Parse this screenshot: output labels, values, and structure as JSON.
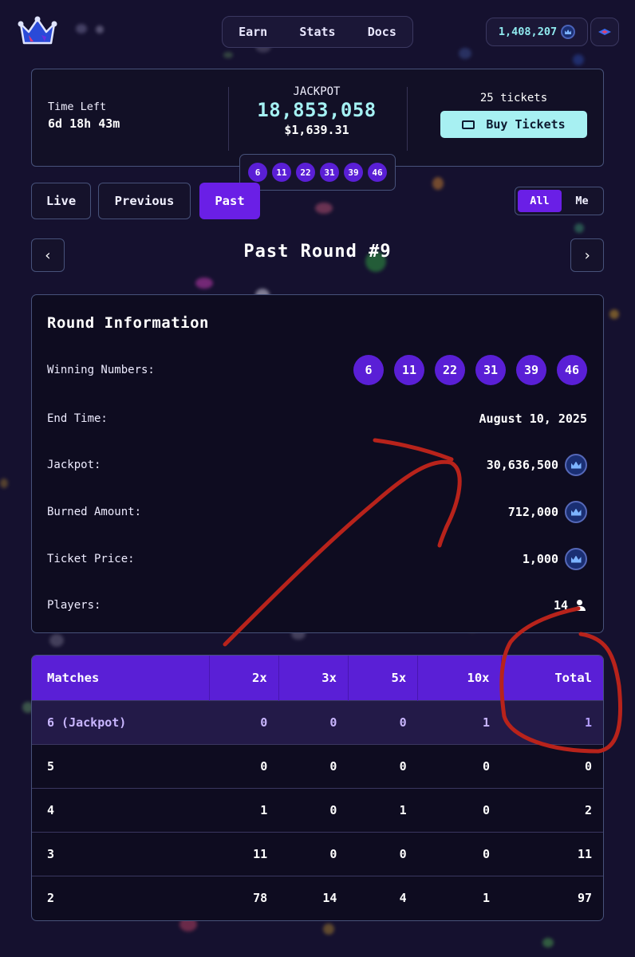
{
  "header": {
    "nav": [
      "Earn",
      "Stats",
      "Docs"
    ],
    "balance": "1,408,207"
  },
  "jackpot_panel": {
    "time_left_label": "Time Left",
    "time_left_value": "6d 18h 43m",
    "jackpot_label": "JACKPOT",
    "jackpot_amount": "18,853,058",
    "jackpot_usd": "$1,639.31",
    "tickets_count": "25 tickets",
    "buy_label": "Buy Tickets",
    "current_numbers": [
      "6",
      "11",
      "22",
      "31",
      "39",
      "46"
    ]
  },
  "tabs": {
    "live": "Live",
    "previous": "Previous",
    "past": "Past",
    "all": "All",
    "me": "Me",
    "active": "Past"
  },
  "round": {
    "title": "Past Round #9",
    "prev_arrow": "‹",
    "next_arrow": "›"
  },
  "round_info": {
    "heading": "Round Information",
    "winning_numbers_label": "Winning Numbers:",
    "winning_numbers": [
      "6",
      "11",
      "22",
      "31",
      "39",
      "46"
    ],
    "end_time_label": "End Time:",
    "end_time": "August 10, 2025",
    "jackpot_label": "Jackpot:",
    "jackpot": "30,636,500",
    "burned_label": "Burned Amount:",
    "burned": "712,000",
    "ticket_price_label": "Ticket Price:",
    "ticket_price": "1,000",
    "players_label": "Players:",
    "players": "14"
  },
  "matches_table": {
    "headers": [
      "Matches",
      "2x",
      "3x",
      "5x",
      "10x",
      "Total"
    ],
    "rows": [
      [
        "6 (Jackpot)",
        "0",
        "0",
        "0",
        "1",
        "1"
      ],
      [
        "5",
        "0",
        "0",
        "0",
        "0",
        "0"
      ],
      [
        "4",
        "1",
        "0",
        "1",
        "0",
        "2"
      ],
      [
        "3",
        "11",
        "0",
        "0",
        "0",
        "11"
      ],
      [
        "2",
        "78",
        "14",
        "4",
        "1",
        "97"
      ]
    ]
  },
  "colors": {
    "background": "#15112f",
    "accent_purple": "#5a1fd6",
    "accent_cyan": "#a7f0f2",
    "annotation_red": "#b8231b"
  }
}
